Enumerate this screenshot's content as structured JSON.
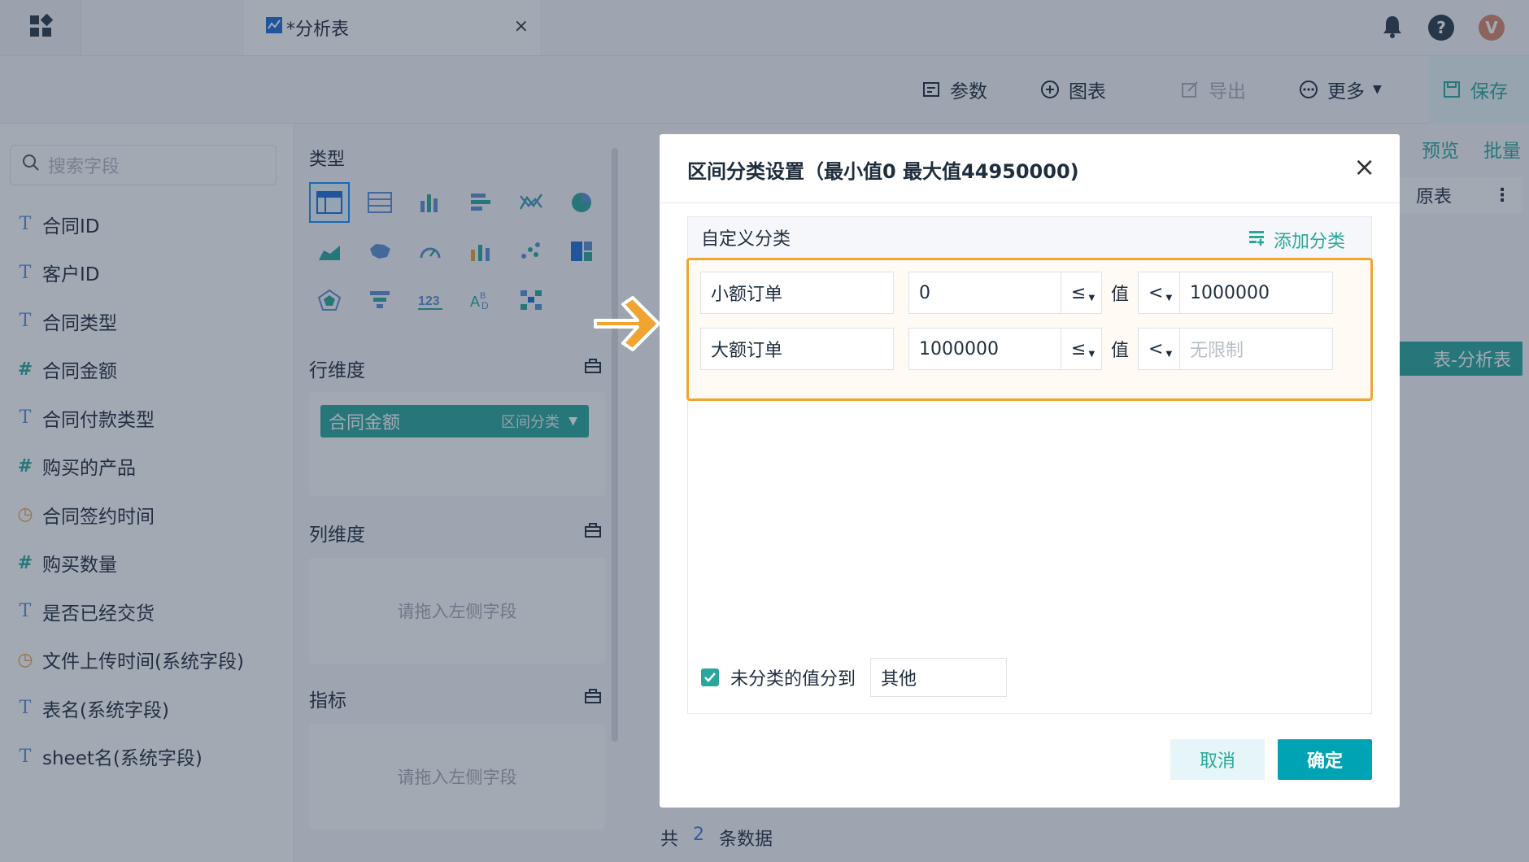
{
  "topbar": {
    "tab_title": "*分析表",
    "tab_close": "×",
    "avatar_letter": "V",
    "colors": {
      "avatar": "#d9886b",
      "bell": "#2b3a4a"
    }
  },
  "toolbar": {
    "params": "参数",
    "chart": "图表",
    "export": "导出",
    "more": "更多",
    "save": "保存"
  },
  "left_panel": {
    "search_placeholder": "搜索字段",
    "fields": [
      {
        "type": "T",
        "label": "合同ID",
        "icon": "text-type-icon"
      },
      {
        "type": "T",
        "label": "客户ID",
        "icon": "text-type-icon"
      },
      {
        "type": "T",
        "label": "合同类型",
        "icon": "text-type-icon"
      },
      {
        "type": "#",
        "label": "合同金额",
        "icon": "number-type-icon"
      },
      {
        "type": "T",
        "label": "合同付款类型",
        "icon": "text-type-icon"
      },
      {
        "type": "#",
        "label": "购买的产品",
        "icon": "number-type-icon"
      },
      {
        "type": "◷",
        "label": "合同签约时间",
        "icon": "date-type-icon"
      },
      {
        "type": "#",
        "label": "购买数量",
        "icon": "number-type-icon"
      },
      {
        "type": "T",
        "label": "是否已经交货",
        "icon": "text-type-icon"
      },
      {
        "type": "◷",
        "label": "文件上传时间(系统字段)",
        "icon": "date-type-icon"
      },
      {
        "type": "T",
        "label": "表名(系统字段)",
        "icon": "text-type-icon"
      },
      {
        "type": "T",
        "label": "sheet名(系统字段)",
        "icon": "text-type-icon"
      }
    ]
  },
  "mid_panel": {
    "type_title": "类型",
    "row_dim_title": "行维度",
    "row_dim_pill": "合同金额",
    "row_dim_pill_sub": "区间分类",
    "col_dim_title": "列维度",
    "col_drop_placeholder": "请拖入左侧字段",
    "metric_title": "指标",
    "metric_drop_placeholder": "请拖入左侧字段"
  },
  "right_panel": {
    "preview": "预览",
    "batch": "批量",
    "source_row": "原表",
    "chip": "表-分析表",
    "total_prefix": "共",
    "total_count": "2",
    "total_suffix": "条数据"
  },
  "modal": {
    "title": "区间分类设置（最小值0 最大值44950000)",
    "close": "×",
    "section_label": "自定义分类",
    "add_category": "添加分类",
    "value_label": "值",
    "rules": [
      {
        "name": "小额订单",
        "min": "0",
        "op_left": "≤",
        "op_right": "<",
        "max": "1000000",
        "max_placeholder": ""
      },
      {
        "name": "大额订单",
        "min": "1000000",
        "op_left": "≤",
        "op_right": "<",
        "max": "",
        "max_placeholder": "无限制"
      }
    ],
    "uncategorized_checked": true,
    "uncategorized_label": "未分类的值分到",
    "uncategorized_value": "其他",
    "cancel": "取消",
    "ok": "确定"
  },
  "colors": {
    "accent": "#2aa79b",
    "primary_button": "#00a3b4",
    "highlight_border": "#f0a431",
    "arrow": "#f0a431"
  }
}
